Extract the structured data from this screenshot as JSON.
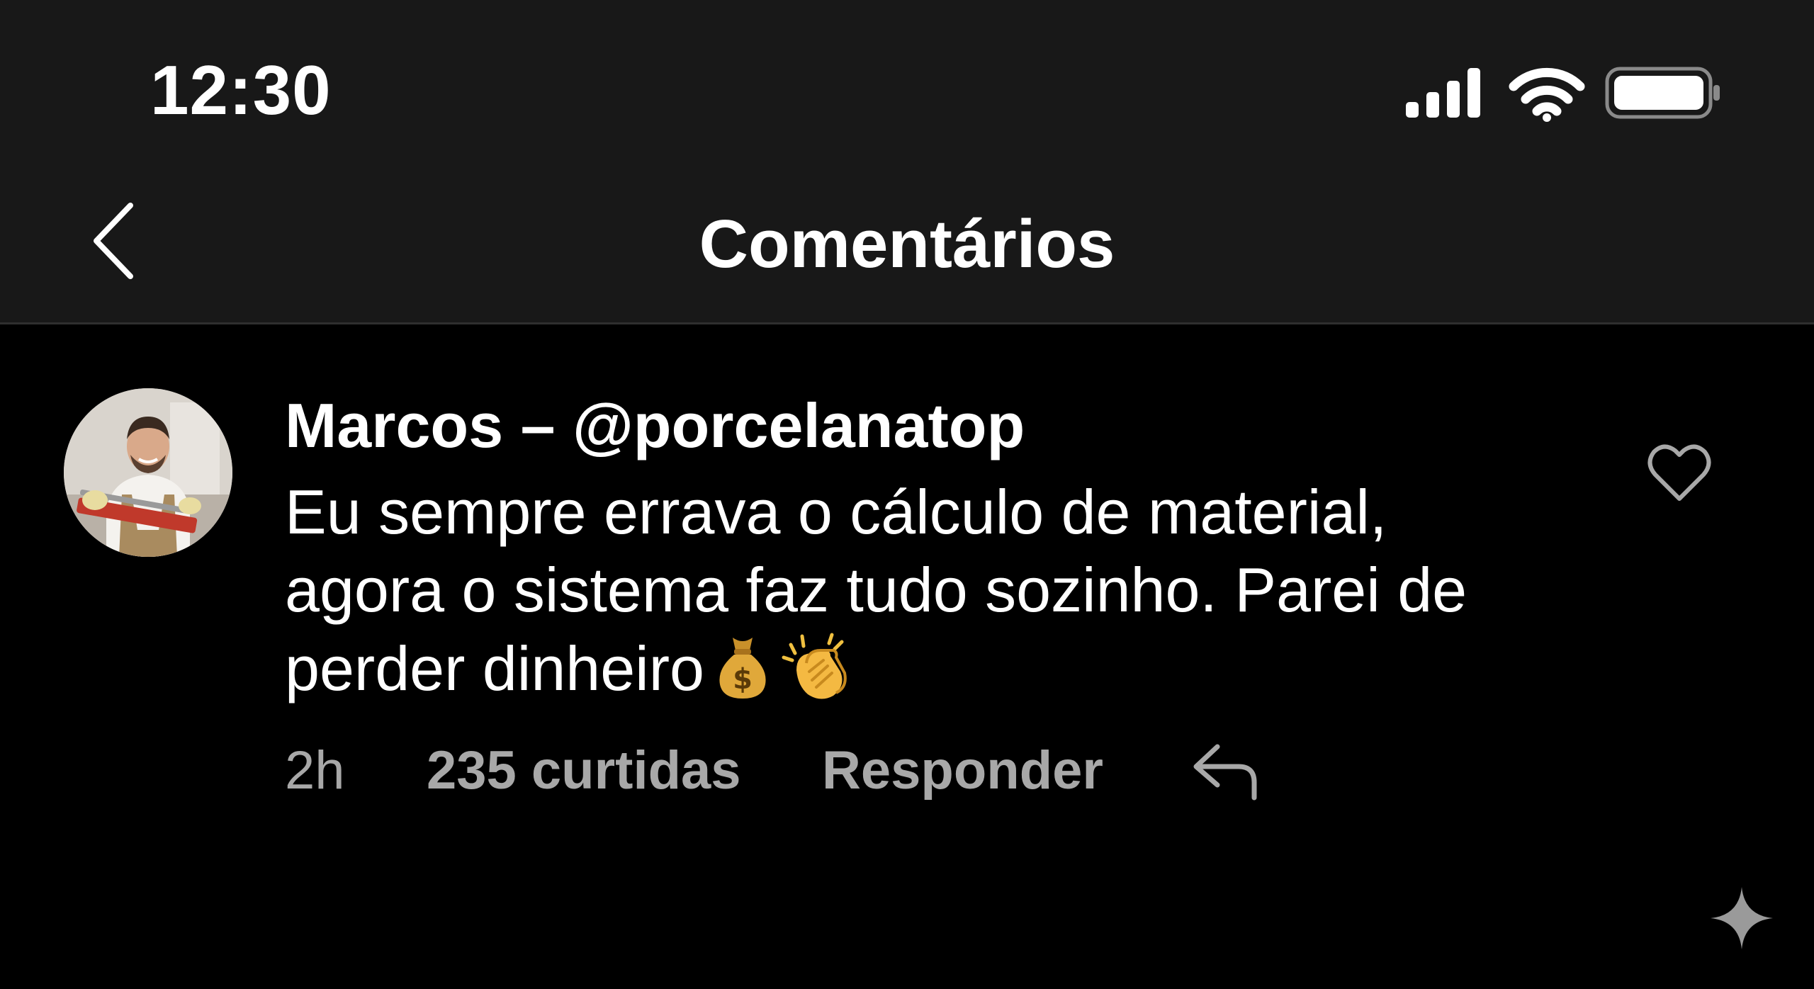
{
  "status_bar": {
    "time": "12:30",
    "icons": [
      "signal-icon",
      "wifi-icon",
      "battery-icon"
    ]
  },
  "header": {
    "back_icon": "chevron-left-icon",
    "title": "Comentários"
  },
  "comment": {
    "author": "Marcos – @porcelanatop",
    "text_lines": [
      "Eu sempre errava o cálculo de material,",
      "agora o sistema faz tudo sozinho. Parei de",
      "perder dinheiro"
    ],
    "emojis": [
      "money-bag-emoji",
      "clapping-hands-emoji"
    ],
    "time_ago": "2h",
    "likes": "235 curtidas",
    "reply_label": "Responder",
    "reply_icon": "reply-arrow-icon",
    "like_icon": "heart-outline-icon"
  },
  "colors": {
    "background": "#000000",
    "header_background": "#181818",
    "primary_text": "#ffffff",
    "secondary_text": "#a8a8a8"
  },
  "corner_icon": "sparkle-icon"
}
